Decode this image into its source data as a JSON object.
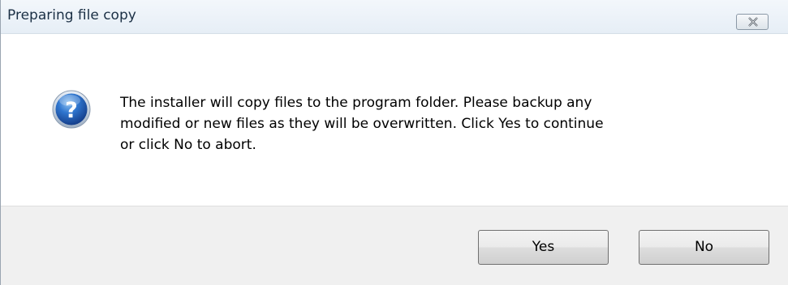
{
  "window": {
    "title": "Preparing file copy",
    "close_icon": "close-icon"
  },
  "dialog": {
    "icon": "question-icon",
    "message_lines": [
      "The installer will copy files to the program folder.  Please backup any",
      "modified or new files as they will be overwritten.  Click Yes to continue",
      "or click No to abort."
    ]
  },
  "buttons": {
    "yes_label": "Yes",
    "no_label": "No"
  },
  "colors": {
    "titlebar": "#e6eef6",
    "footer": "#f0f0f0",
    "icon_blue": "#1f5fb8"
  }
}
